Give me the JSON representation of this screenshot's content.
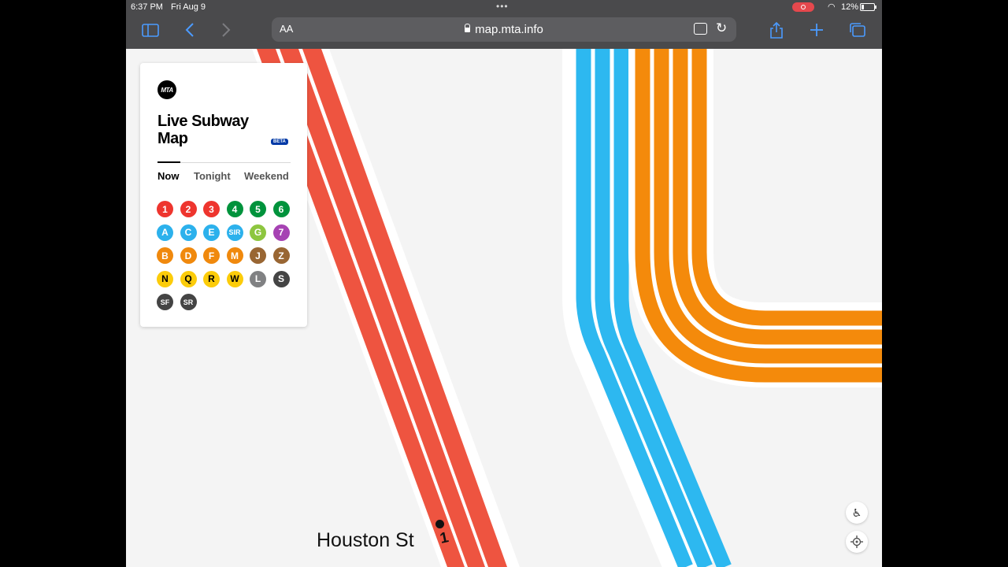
{
  "status_bar": {
    "time": "6:37 PM",
    "date": "Fri Aug 9",
    "battery": "12%"
  },
  "browser": {
    "text_size_label": "AA",
    "url": "map.mta.info"
  },
  "panel": {
    "title": "Live Subway Map",
    "badge": "BETA",
    "tabs": [
      {
        "label": "Now",
        "active": true
      },
      {
        "label": "Tonight",
        "active": false
      },
      {
        "label": "Weekend",
        "active": false
      }
    ],
    "routes": [
      {
        "label": "1",
        "color": "#ee352e"
      },
      {
        "label": "2",
        "color": "#ee352e"
      },
      {
        "label": "3",
        "color": "#ee352e"
      },
      {
        "label": "4",
        "color": "#00933c"
      },
      {
        "label": "5",
        "color": "#00933c"
      },
      {
        "label": "6",
        "color": "#00933c"
      },
      {
        "label": "A",
        "color": "#2cb1ec"
      },
      {
        "label": "C",
        "color": "#2cb1ec"
      },
      {
        "label": "E",
        "color": "#2cb1ec"
      },
      {
        "label": "SIR",
        "color": "#2cb1ec"
      },
      {
        "label": "G",
        "color": "#8dc63f"
      },
      {
        "label": "7",
        "color": "#a642b3"
      },
      {
        "label": "B",
        "color": "#f0890d"
      },
      {
        "label": "D",
        "color": "#f0890d"
      },
      {
        "label": "F",
        "color": "#f0890d"
      },
      {
        "label": "M",
        "color": "#f0890d"
      },
      {
        "label": "J",
        "color": "#996633"
      },
      {
        "label": "Z",
        "color": "#996633"
      },
      {
        "label": "N",
        "color": "#fccc0a"
      },
      {
        "label": "Q",
        "color": "#fccc0a"
      },
      {
        "label": "R",
        "color": "#fccc0a"
      },
      {
        "label": "W",
        "color": "#fccc0a"
      },
      {
        "label": "L",
        "color": "#808183"
      },
      {
        "label": "S",
        "color": "#444444"
      },
      {
        "label": "SF",
        "color": "#444444"
      },
      {
        "label": "SR",
        "color": "#444444"
      }
    ]
  },
  "map": {
    "station": "Houston St",
    "station_route": "1",
    "line_colors": {
      "red": "#ee5440",
      "blue": "#2db8f0",
      "orange": "#f48a0b"
    }
  }
}
